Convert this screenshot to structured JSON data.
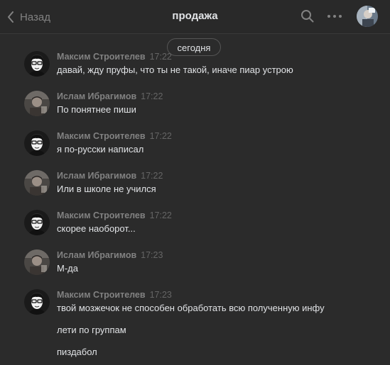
{
  "header": {
    "back_label": "Назад",
    "title": "продажа"
  },
  "date_separator": "сегодня",
  "messages": [
    {
      "author": "Максим Строителев",
      "time": "17:22",
      "avatar": "cartoon-man-glasses",
      "lines": [
        "давай, жду пруфы, что ты не такой, иначе пиар устрою"
      ]
    },
    {
      "author": "Ислам Ибрагимов",
      "time": "17:22",
      "avatar": "photo",
      "lines": [
        "По понятнее пиши"
      ]
    },
    {
      "author": "Максим Строителев",
      "time": "17:22",
      "avatar": "cartoon-man-glasses",
      "lines": [
        "я по-русски написал"
      ]
    },
    {
      "author": "Ислам Ибрагимов",
      "time": "17:22",
      "avatar": "photo",
      "lines": [
        "Или в школе не учился"
      ]
    },
    {
      "author": "Максим Строителев",
      "time": "17:22",
      "avatar": "cartoon-man-glasses",
      "lines": [
        "скорее наоборот..."
      ]
    },
    {
      "author": "Ислам Ибрагимов",
      "time": "17:23",
      "avatar": "photo",
      "lines": [
        "М-да"
      ]
    },
    {
      "author": "Максим Строителев",
      "time": "17:23",
      "avatar": "cartoon-man-glasses",
      "lines": [
        "твой мозжечок не способен обработать всю полученную инфу",
        "лети по группам",
        "пиздабол"
      ]
    }
  ]
}
